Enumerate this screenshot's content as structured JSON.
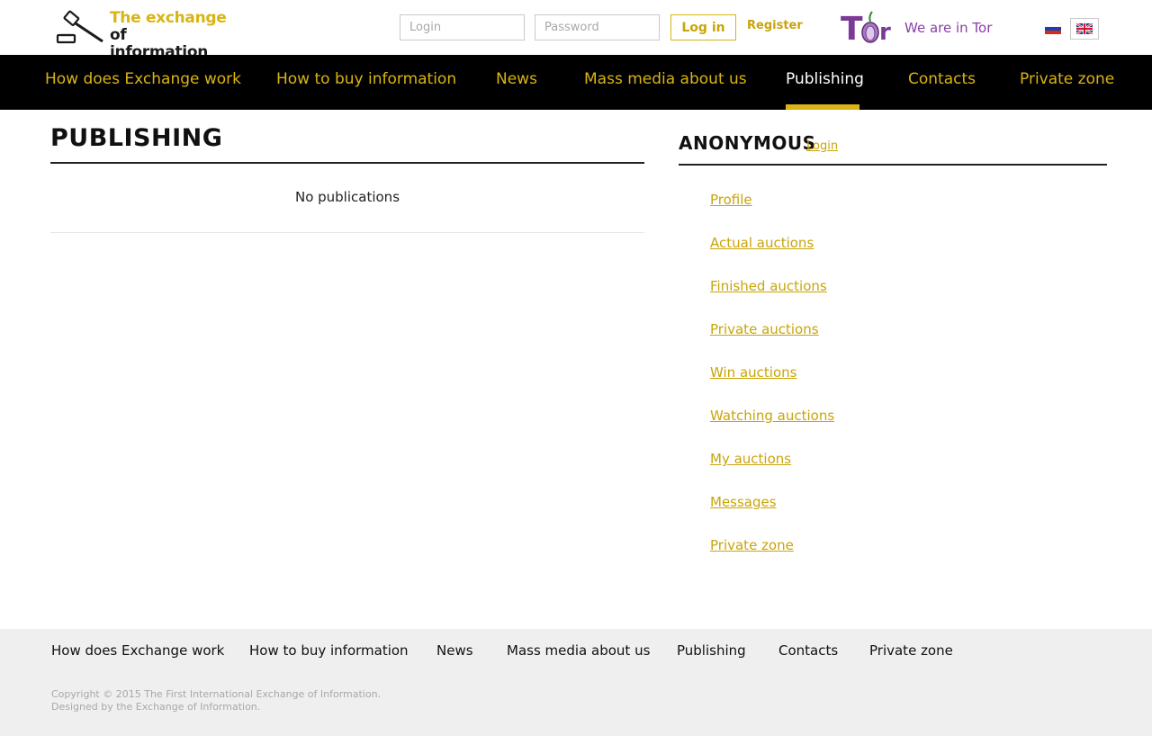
{
  "logo": {
    "line1": "The exchange",
    "line2": "of information",
    "icon": "gavel-icon"
  },
  "auth": {
    "login_placeholder": "Login",
    "password_placeholder": "Password",
    "login_button": "Log in",
    "register_link": "Register"
  },
  "tor": {
    "logo_text": "Tor",
    "label": "We are in Tor"
  },
  "languages": [
    {
      "code": "ru",
      "icon": "russia-flag-icon"
    },
    {
      "code": "en",
      "icon": "uk-flag-icon",
      "selected": true
    }
  ],
  "nav": {
    "items": [
      {
        "label": "How does Exchange work"
      },
      {
        "label": "How to buy information"
      },
      {
        "label": "News"
      },
      {
        "label": "Mass media about us"
      },
      {
        "label": "Publishing",
        "active": true
      },
      {
        "label": "Contacts"
      },
      {
        "label": "Private zone"
      }
    ]
  },
  "main": {
    "title": "PUBLISHING",
    "empty_message": "No publications"
  },
  "sidebar": {
    "title": "ANONYMOUS",
    "login_link": "Login",
    "items": [
      {
        "label": "Profile"
      },
      {
        "label": "Actual auctions"
      },
      {
        "label": "Finished auctions"
      },
      {
        "label": "Private auctions"
      },
      {
        "label": "Win auctions"
      },
      {
        "label": "Watching auctions"
      },
      {
        "label": "My auctions"
      },
      {
        "label": "Messages"
      },
      {
        "label": "Private zone"
      }
    ]
  },
  "footer": {
    "nav": [
      {
        "label": "How does Exchange work"
      },
      {
        "label": "How to buy information"
      },
      {
        "label": "News"
      },
      {
        "label": "Mass media about us"
      },
      {
        "label": "Publishing"
      },
      {
        "label": "Contacts"
      },
      {
        "label": "Private zone"
      }
    ],
    "copyright_line1": "Copyright © 2015 The First International Exchange of Information.",
    "copyright_line2": "Designed by the Exchange of Information."
  },
  "colors": {
    "accent": "#d9b414",
    "nav_bg": "#000000",
    "footer_bg": "#efefef",
    "tor_purple": "#8a3fa8"
  }
}
